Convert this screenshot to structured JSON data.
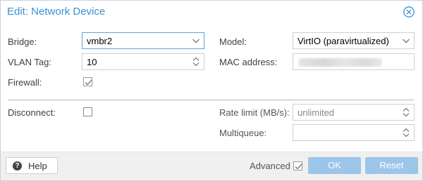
{
  "dialog": {
    "title": "Edit: Network Device"
  },
  "left": {
    "bridge_label": "Bridge:",
    "bridge_value": "vmbr2",
    "vlan_label": "VLAN Tag:",
    "vlan_value": "10",
    "firewall_label": "Firewall:",
    "firewall_checked": true,
    "disconnect_label": "Disconnect:",
    "disconnect_checked": false
  },
  "right": {
    "model_label": "Model:",
    "model_value": "VirtIO (paravirtualized)",
    "mac_label": "MAC address:",
    "rate_label": "Rate limit (MB/s):",
    "rate_placeholder": "unlimited",
    "multiqueue_label": "Multiqueue:",
    "multiqueue_value": ""
  },
  "footer": {
    "help_label": "Help",
    "advanced_label": "Advanced",
    "advanced_checked": true,
    "ok_label": "OK",
    "reset_label": "Reset"
  },
  "colors": {
    "accent": "#3892d4",
    "button_disabled": "#9cc5ea",
    "focus_border": "#5fa2dd"
  },
  "icons": {
    "close": "close-circle-icon",
    "dropdown": "chevron-down-icon",
    "spinner": "spinner-arrows-icon",
    "help": "question-circle-icon",
    "check": "checkmark-icon"
  }
}
